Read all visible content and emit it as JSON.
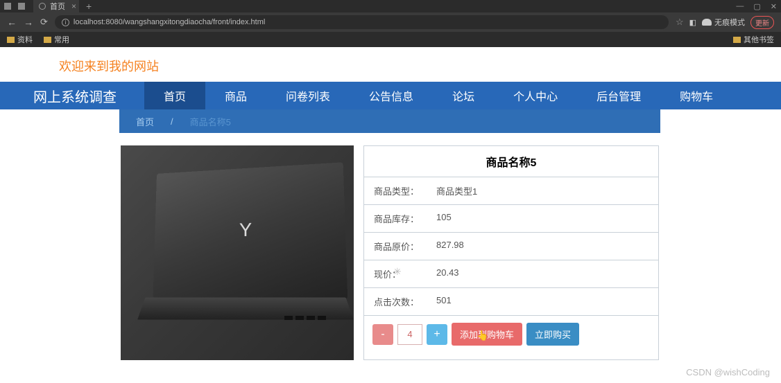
{
  "browser": {
    "tab_title": "首页",
    "url": "localhost:8080/wangshangxitongdiaocha/front/index.html",
    "incognito_label": "无痕模式",
    "update_label": "更新"
  },
  "bookmarks": {
    "item1": "资料",
    "item2": "常用",
    "other": "其他书签"
  },
  "page": {
    "welcome": "欢迎来到我的网站",
    "brand": "网上系统调查"
  },
  "nav": {
    "home": "首页",
    "goods": "商品",
    "survey": "问卷列表",
    "notice": "公告信息",
    "forum": "论坛",
    "personal": "个人中心",
    "admin": "后台管理",
    "cart": "购物车"
  },
  "breadcrumb": {
    "home": "首页",
    "sep": "/",
    "current": "商品名称5"
  },
  "product": {
    "title": "商品名称5",
    "labels": {
      "type": "商品类型：",
      "stock": "商品库存：",
      "orig_price": "商品原价：",
      "price": "现价：",
      "clicks": "点击次数："
    },
    "values": {
      "type": "商品类型1",
      "stock": "105",
      "orig_price": "827.98",
      "price": "20.43",
      "clicks": "501"
    },
    "qty": "4",
    "add_cart": "添加到购物车",
    "buy_now": "立即购买"
  },
  "watermark": "CSDN @wishCoding"
}
